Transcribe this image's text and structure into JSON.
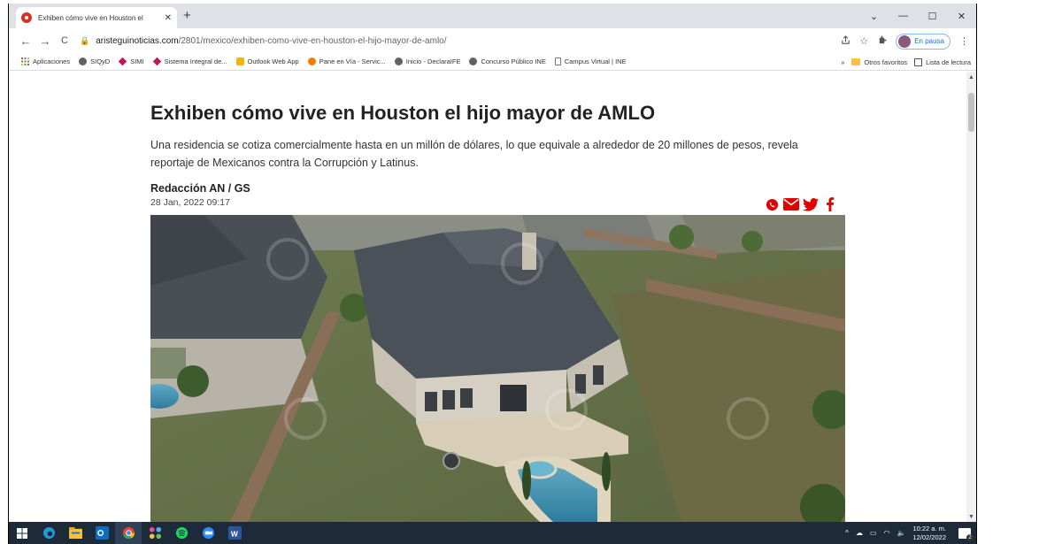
{
  "browser": {
    "tab": {
      "title": "Exhiben cómo vive en Houston el",
      "close": "✕",
      "new_tab": "+"
    },
    "window_controls": {
      "menu": "⌄",
      "minimize": "—",
      "maximize": "☐",
      "close": "✕"
    },
    "nav": {
      "back": "←",
      "forward": "→",
      "reload": "C"
    },
    "url": {
      "domain": "aristeguinoticias.com",
      "path": "/2801/mexico/exhiben-como-vive-en-houston-el-hijo-mayor-de-amlo/"
    },
    "profile": {
      "label": "En pausa"
    },
    "bookmarks": [
      {
        "label": "Aplicaciones",
        "color": "#4285f4"
      },
      {
        "label": "SIQyD",
        "color": "#5f6368"
      },
      {
        "label": "SIMI",
        "color": "#c2185b"
      },
      {
        "label": "Sistema Integral de...",
        "color": "#c2185b"
      },
      {
        "label": "Outlook Web App",
        "color": "#f4b400"
      },
      {
        "label": "Pane en Vía - Servic...",
        "color": "#f57c00"
      },
      {
        "label": "Inicio - DeclaraIFE",
        "color": "#5f6368"
      },
      {
        "label": "Concurso Público INE",
        "color": "#5f6368"
      },
      {
        "label": "Campus Virtual | INE",
        "color": "#9e9e9e"
      }
    ],
    "bookmarks_right": {
      "overflow": "»",
      "other": "Otros favoritos",
      "reading": "Lista de lectura"
    }
  },
  "article": {
    "headline": "Exhiben cómo vive en Houston el hijo mayor de AMLO",
    "lead": "Una residencia se cotiza comercialmente hasta en un millón de dólares, lo que equivale a alrededor de 20 millones de pesos, revela reportaje de Mexicanos contra la Corrupción y Latinus.",
    "byline": "Redacción AN / GS",
    "date": "28 Jan, 2022 09:17",
    "share_colors": {
      "icons": "#e00000"
    }
  },
  "taskbar": {
    "clock_time": "10:22 a. m.",
    "clock_date": "12/02/2022",
    "notifications": "2"
  }
}
